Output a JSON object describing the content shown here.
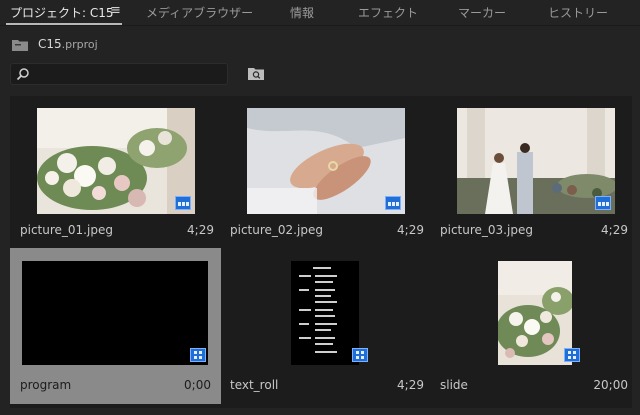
{
  "tabs": [
    {
      "label": "プロジェクト: C15",
      "active": true
    },
    {
      "label": "メディアブラウザー",
      "active": false
    },
    {
      "label": "情報",
      "active": false
    },
    {
      "label": "エフェクト",
      "active": false
    },
    {
      "label": "マーカー",
      "active": false
    },
    {
      "label": "ヒストリー",
      "active": false
    }
  ],
  "tab_menu_icon": "hamburger-icon",
  "project": {
    "name": "C15",
    "ext": ".prproj"
  },
  "search": {
    "value": "",
    "placeholder": ""
  },
  "items": [
    {
      "name": "picture_01.jpeg",
      "duration": "4;29",
      "type": "still-image",
      "selected": false
    },
    {
      "name": "picture_02.jpeg",
      "duration": "4;29",
      "type": "still-image",
      "selected": false
    },
    {
      "name": "picture_03.jpeg",
      "duration": "4;29",
      "type": "still-image",
      "selected": false
    },
    {
      "name": "program",
      "duration": "0;00",
      "type": "sequence",
      "selected": true
    },
    {
      "name": "text_roll",
      "duration": "4;29",
      "type": "sequence",
      "selected": false
    },
    {
      "name": "slide",
      "duration": "20;00",
      "type": "sequence",
      "selected": false
    }
  ],
  "colors": {
    "selection_border": "#e01818",
    "badge": "#1f6fd6",
    "panel_bg": "#232323"
  }
}
